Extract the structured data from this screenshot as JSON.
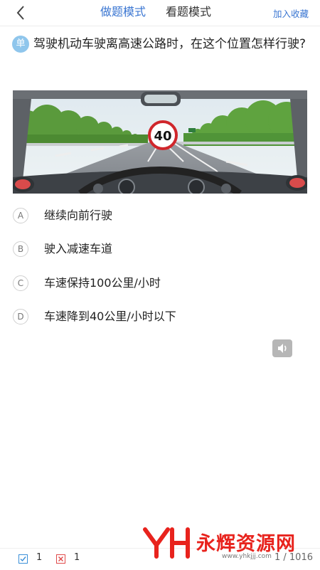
{
  "header": {
    "tab_active": "做题模式",
    "tab_inactive": "看题模式",
    "favorite": "加入收藏"
  },
  "question": {
    "type_badge": "单",
    "text": "驾驶机动车驶离高速公路时，在这个位置怎样行驶?"
  },
  "scene": {
    "speed_sign": "40"
  },
  "options": [
    {
      "letter": "A",
      "text": "继续向前行驶"
    },
    {
      "letter": "B",
      "text": "驶入减速车道"
    },
    {
      "letter": "C",
      "text": "车速保持100公里/小时"
    },
    {
      "letter": "D",
      "text": "车速降到40公里/小时以下"
    }
  ],
  "footer": {
    "correct_count": "1",
    "wrong_count": "1",
    "pager": "1 / 1016"
  },
  "watermark": {
    "brand": "永辉资源网",
    "url": "www.yhkjjj.com"
  },
  "colors": {
    "accent": "#3a76d2",
    "badge": "#8fc6ec",
    "watermark": "#e8231d"
  }
}
